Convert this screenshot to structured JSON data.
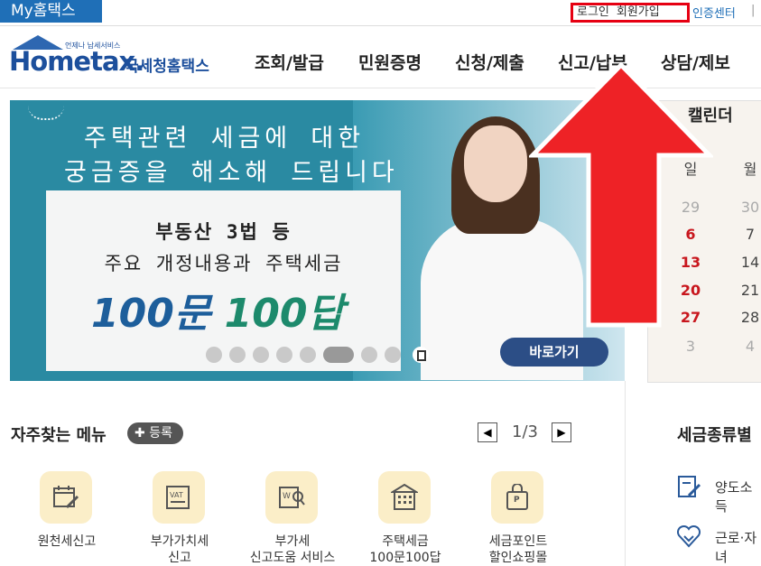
{
  "topbar": {
    "my_hometax": "My홈택스",
    "login": "로그인",
    "signup": "회원가입",
    "cert_center": "인증센터",
    "separator": "|"
  },
  "header": {
    "logo_word": "Hometax.",
    "logo_korean": "국세청홈택스",
    "logo_small": "언제나 납세서비스",
    "nav": [
      "조회/발급",
      "민원증명",
      "신청/제출",
      "신고/납부",
      "상담/제보"
    ]
  },
  "banner": {
    "headline_line1": "주택관련 세금에 대한",
    "headline_line2": "궁금증을 해소해 드립니다",
    "card_line1": "부동산 3법 등",
    "card_line2": "주요 개정내용과 주택세금",
    "card_big_a": "100문",
    "card_big_b": "100답",
    "go_button": "바로가기",
    "slide_count": 9,
    "active_slide": 6
  },
  "calendar": {
    "title": "캘린더",
    "headers": [
      "일",
      "월"
    ],
    "rows": [
      [
        "29",
        "30"
      ],
      [
        "6",
        "7"
      ],
      [
        "13",
        "14"
      ],
      [
        "20",
        "21"
      ],
      [
        "27",
        "28"
      ],
      [
        "3",
        "4"
      ]
    ]
  },
  "frequent_menu": {
    "title": "자주찾는 메뉴",
    "register": "등록",
    "page": "1/3",
    "items": [
      {
        "icon": "calendar-edit-icon",
        "line1": "원천세신고",
        "line2": ""
      },
      {
        "icon": "vat-icon",
        "line1": "부가가치세",
        "line2": "신고"
      },
      {
        "icon": "document-search-icon",
        "line1": "부가세",
        "line2": "신고도움 서비스"
      },
      {
        "icon": "building-icon",
        "line1": "주택세금",
        "line2": "100문100답"
      },
      {
        "icon": "shopping-bag-icon",
        "line1": "세금포인트",
        "line2": "할인쇼핑몰"
      }
    ]
  },
  "tax_types": {
    "title": "세금종류별",
    "items": [
      {
        "icon": "document-pen-icon",
        "label": "양도소득"
      },
      {
        "icon": "heart-hand-icon",
        "label": "근로·자녀"
      }
    ]
  },
  "colors": {
    "brand": "#1f6fb7",
    "nav_text": "#222222",
    "highlight_box": "#e60012",
    "arrow": "#ee2226",
    "calendar_red": "#c8161d"
  }
}
